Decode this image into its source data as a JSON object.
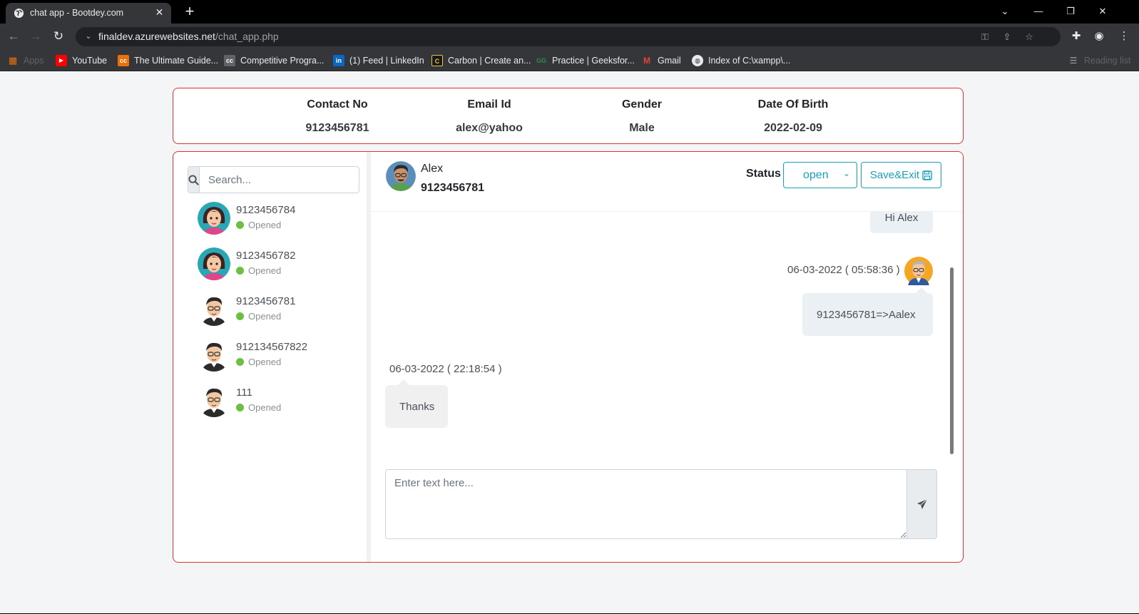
{
  "browser": {
    "tab_title": "chat app - Bootdey.com",
    "url_host": "finaldev.azurewebsites.net",
    "url_path": "/chat_app.php",
    "bookmarks": [
      {
        "label": "Apps",
        "icon": "apps-grid-icon",
        "color": "#e8710a"
      },
      {
        "label": "YouTube",
        "icon": "youtube-icon",
        "color": "#ff0000"
      },
      {
        "label": "The Ultimate Guide...",
        "icon": "bookmark-cc-icon",
        "color": "#e8710a"
      },
      {
        "label": "Competitive Progra...",
        "icon": "bookmark-cc-icon",
        "color": "#5f6368"
      },
      {
        "label": "(1) Feed | LinkedIn",
        "icon": "linkedin-icon",
        "color": "#0a66c2"
      },
      {
        "label": "Carbon | Create an...",
        "icon": "carbon-icon",
        "color": "#1a1a1a"
      },
      {
        "label": "Practice | Geeksfor...",
        "icon": "geeksforgeeks-icon",
        "color": "#2f8d46"
      },
      {
        "label": "Gmail",
        "icon": "gmail-icon",
        "color": "#ea4335"
      },
      {
        "label": "Index of C:\\xampp\\...",
        "icon": "globe-icon",
        "color": "#e8eaed"
      },
      {
        "label": "Reading list",
        "icon": "reading-list-icon",
        "color": "#9aa0a6"
      }
    ]
  },
  "info": {
    "contact_label": "Contact No",
    "contact_value": "9123456781",
    "email_label": "Email Id",
    "email_value": "alex@yahoo",
    "gender_label": "Gender",
    "gender_value": "Male",
    "dob_label": "Date Of Birth",
    "dob_value": "2022-02-09"
  },
  "search": {
    "placeholder": "Search..."
  },
  "people": [
    {
      "name": "9123456784",
      "status": "Opened",
      "avatar": "female"
    },
    {
      "name": "9123456782",
      "status": "Opened",
      "avatar": "female"
    },
    {
      "name": "9123456781",
      "status": "Opened",
      "avatar": "male"
    },
    {
      "name": "912134567822",
      "status": "Opened",
      "avatar": "male"
    },
    {
      "name": "111",
      "status": "Opened",
      "avatar": "male"
    }
  ],
  "chat_header": {
    "name": "Alex",
    "phone": "9123456781",
    "status_label": "Status",
    "status_value": "open",
    "save_label": "Save&Exit"
  },
  "messages": [
    {
      "side": "right",
      "text": "Hi Alex"
    },
    {
      "side": "right",
      "timestamp": "06-03-2022 ( 05:58:36 )",
      "text": "9123456781=>Aalex"
    },
    {
      "side": "left",
      "timestamp": "06-03-2022 ( 22:18:54 )",
      "text": "Thanks"
    }
  ],
  "composer": {
    "placeholder": "Enter text here..."
  },
  "colors": {
    "card_border": "#e03131",
    "accent": "#17a2b8",
    "online": "#6cbf43"
  }
}
